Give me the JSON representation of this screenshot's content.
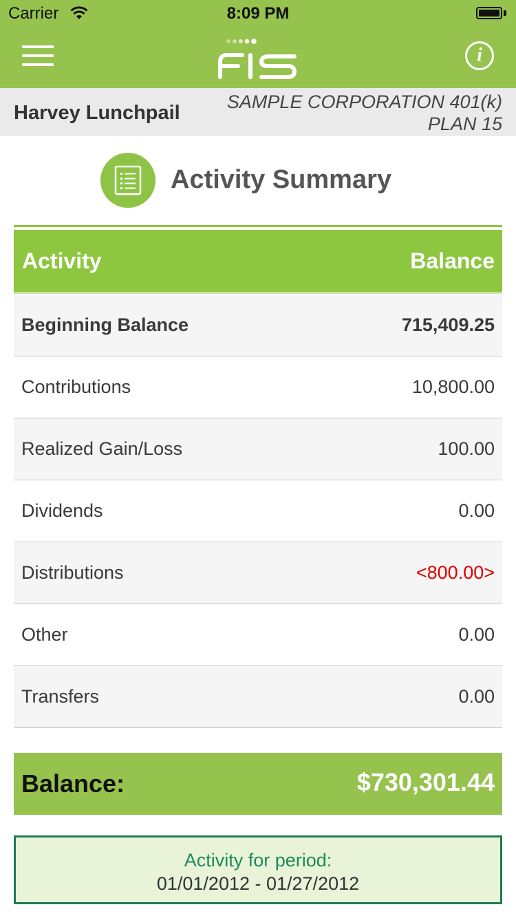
{
  "status_bar": {
    "carrier": "Carrier",
    "time": "8:09 PM",
    "icons": [
      "wifi-icon",
      "battery-icon"
    ]
  },
  "nav_bar": {
    "logo": "FIS",
    "icons": [
      "menu-icon",
      "info-icon"
    ],
    "info_glyph": "i"
  },
  "account": {
    "participant_name": "Harvey Lunchpail",
    "plan_line1": "SAMPLE CORPORATION 401(k)",
    "plan_line2": "PLAN 15"
  },
  "page": {
    "title": "Activity Summary",
    "icon": "list-document-icon"
  },
  "table": {
    "headers": {
      "activity": "Activity",
      "balance": "Balance"
    },
    "rows": [
      {
        "label": "Beginning Balance",
        "value": "715,409.25",
        "bold": true,
        "negative": false
      },
      {
        "label": "Contributions",
        "value": "10,800.00",
        "bold": false,
        "negative": false
      },
      {
        "label": "Realized Gain/Loss",
        "value": "100.00",
        "bold": false,
        "negative": false
      },
      {
        "label": "Dividends",
        "value": "0.00",
        "bold": false,
        "negative": false
      },
      {
        "label": "Distributions",
        "value": "<800.00>",
        "bold": false,
        "negative": true
      },
      {
        "label": "Other",
        "value": "0.00",
        "bold": false,
        "negative": false
      },
      {
        "label": "Transfers",
        "value": "0.00",
        "bold": false,
        "negative": false
      }
    ]
  },
  "balance": {
    "label": "Balance:",
    "value": "$730,301.44"
  },
  "period": {
    "label": "Activity for period:",
    "range": "01/01/2012 - 01/27/2012"
  },
  "colors": {
    "brand_green": "#96c24e",
    "header_green": "#8dc63f",
    "negative_red": "#e00000",
    "period_border": "#1b7a55"
  }
}
